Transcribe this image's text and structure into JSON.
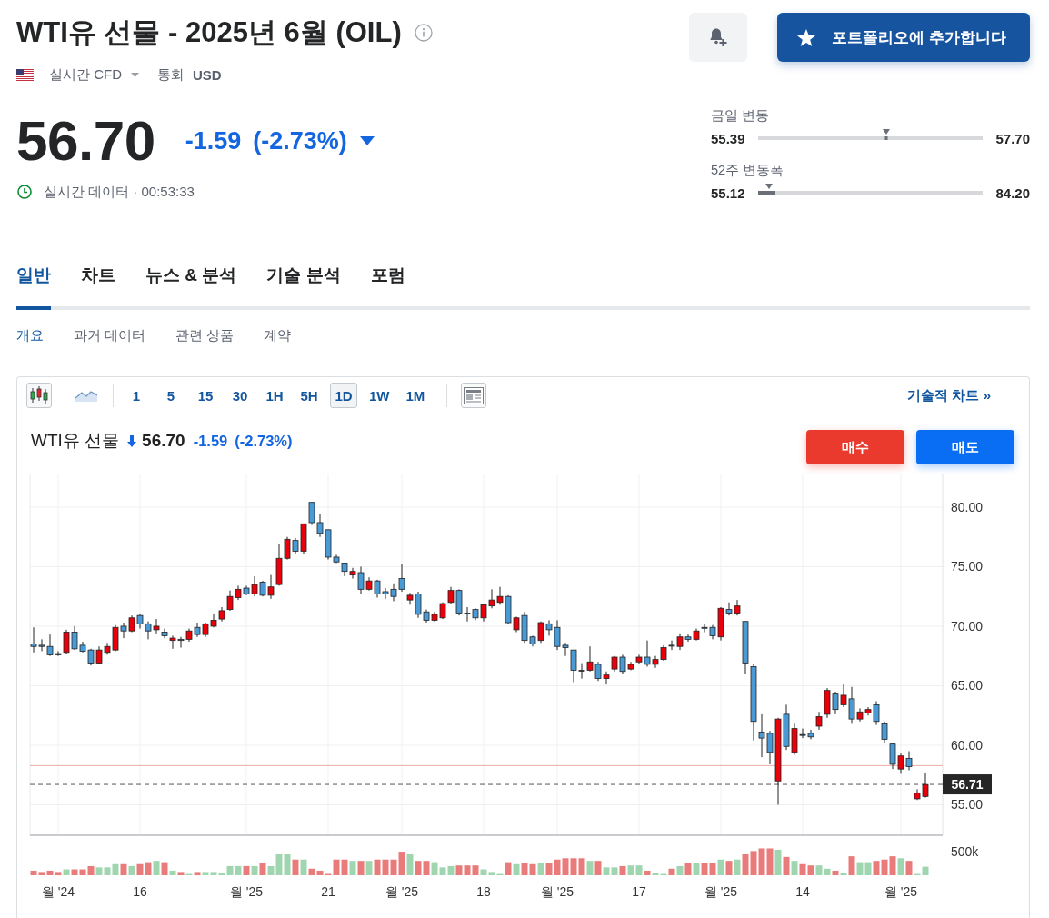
{
  "header": {
    "title": "WTI유 선물 - 2025년 6월 (OIL)",
    "market": "실시간 CFD",
    "currency_label": "통화",
    "currency": "USD"
  },
  "portfolio_button": {
    "label": "포트폴리오에 추가합니다"
  },
  "quote": {
    "price": "56.70",
    "change": "-1.59",
    "change_percent": "(-2.73%)",
    "falling": true,
    "status": "실시간 데이터 · 00:53:33"
  },
  "ranges": [
    {
      "kind": "day",
      "label": "금일 변동",
      "low": "55.39",
      "high": "57.70",
      "level": 0.57
    },
    {
      "kind": "year",
      "label": "52주 변동폭",
      "low": "55.12",
      "high": "84.20",
      "level": 0.05
    }
  ],
  "tabs": [
    {
      "label": "일반",
      "selected": true
    },
    {
      "label": "차트",
      "selected": false
    },
    {
      "label": "뉴스 & 분석",
      "selected": false
    },
    {
      "label": "기술 분석",
      "selected": false
    },
    {
      "label": "포럼",
      "selected": false
    }
  ],
  "subtabs": [
    {
      "label": "개요",
      "selected": true
    },
    {
      "label": "과거 데이터",
      "selected": false
    },
    {
      "label": "관련 상품",
      "selected": false
    },
    {
      "label": "계약",
      "selected": false
    }
  ],
  "chart": {
    "chart_types": [
      {
        "kind": "candlestick",
        "selected": true
      },
      {
        "kind": "area",
        "selected": false
      }
    ],
    "intervals": [
      {
        "label": "1",
        "selected": false
      },
      {
        "label": "5",
        "selected": false
      },
      {
        "label": "15",
        "selected": false
      },
      {
        "label": "30",
        "selected": false
      },
      {
        "label": "1H",
        "selected": false
      },
      {
        "label": "5H",
        "selected": false
      },
      {
        "label": "1D",
        "selected": true
      },
      {
        "label": "1W",
        "selected": false
      },
      {
        "label": "1M",
        "selected": false
      }
    ],
    "technical_link": "기술적 차트 »",
    "legend": {
      "name": "WTI유 선물",
      "falling": true,
      "price": "56.70",
      "change": "-1.59",
      "change_percent": "(-2.73%)"
    },
    "trade_buttons": [
      {
        "kind": "buy",
        "label": "매수"
      },
      {
        "kind": "sell",
        "label": "매도"
      }
    ],
    "volume_axis_label": "500k",
    "chart_data": {
      "type": "candlestick",
      "grid": true,
      "categories": [
        null,
        null,
        null,
        "월 '24",
        null,
        null,
        null,
        null,
        null,
        null,
        null,
        null,
        null,
        "16",
        null,
        null,
        null,
        null,
        null,
        null,
        null,
        null,
        null,
        null,
        null,
        null,
        "월 '25",
        null,
        null,
        null,
        null,
        null,
        null,
        null,
        null,
        null,
        "21",
        null,
        null,
        null,
        null,
        null,
        null,
        null,
        null,
        "월 '25",
        null,
        null,
        null,
        null,
        null,
        null,
        null,
        null,
        null,
        "18",
        null,
        null,
        null,
        null,
        null,
        null,
        null,
        null,
        "월 '25",
        null,
        null,
        null,
        null,
        null,
        null,
        null,
        null,
        null,
        "17",
        null,
        null,
        null,
        null,
        null,
        null,
        null,
        null,
        null,
        "월 '25",
        null,
        null,
        null,
        null,
        null,
        null,
        null,
        null,
        null,
        "14",
        null,
        null,
        null,
        null,
        null,
        null,
        null,
        null,
        null,
        null,
        null,
        "월 '25",
        null,
        null,
        null
      ],
      "ohlc": [
        [
          68.5,
          69.9,
          67.8,
          68.3
        ],
        [
          68.4,
          68.9,
          67.9,
          68.3
        ],
        [
          68.3,
          69.3,
          67.5,
          67.6
        ],
        [
          67.7,
          67.9,
          67.5,
          67.6
        ],
        [
          67.8,
          69.7,
          67.7,
          69.5
        ],
        [
          69.5,
          70.0,
          68.0,
          68.1
        ],
        [
          68.4,
          68.7,
          67.8,
          67.9
        ],
        [
          68.0,
          68.1,
          66.7,
          66.9
        ],
        [
          66.9,
          68.3,
          66.8,
          68.0
        ],
        [
          67.8,
          68.6,
          67.6,
          68.3
        ],
        [
          68.0,
          70.1,
          67.9,
          69.9
        ],
        [
          70.0,
          70.3,
          69.0,
          69.6
        ],
        [
          69.6,
          70.9,
          69.5,
          70.7
        ],
        [
          70.9,
          71.0,
          69.8,
          70.2
        ],
        [
          70.2,
          70.4,
          68.9,
          69.6
        ],
        [
          69.7,
          70.6,
          69.4,
          70.0
        ],
        [
          69.5,
          69.8,
          69.0,
          69.2
        ],
        [
          68.8,
          69.2,
          68.1,
          69.0
        ],
        [
          68.9,
          69.1,
          68.2,
          68.8
        ],
        [
          68.9,
          69.8,
          68.7,
          69.6
        ],
        [
          69.9,
          70.3,
          69.1,
          69.3
        ],
        [
          69.3,
          70.3,
          69.1,
          70.2
        ],
        [
          70.0,
          71.0,
          69.9,
          70.5
        ],
        [
          70.6,
          71.6,
          70.4,
          71.3
        ],
        [
          71.4,
          73.0,
          71.3,
          72.5
        ],
        [
          72.4,
          73.4,
          72.2,
          73.1
        ],
        [
          73.2,
          73.4,
          72.6,
          72.7
        ],
        [
          72.7,
          74.2,
          72.5,
          73.5
        ],
        [
          73.7,
          73.8,
          72.5,
          72.6
        ],
        [
          72.6,
          74.3,
          72.3,
          73.3
        ],
        [
          73.5,
          76.9,
          73.4,
          75.7
        ],
        [
          75.7,
          77.5,
          75.6,
          77.3
        ],
        [
          77.2,
          77.4,
          76.1,
          76.3
        ],
        [
          76.3,
          78.6,
          76.1,
          78.6
        ],
        [
          80.4,
          80.4,
          78.5,
          78.7
        ],
        [
          78.7,
          79.4,
          77.5,
          77.8
        ],
        [
          78.1,
          78.1,
          75.6,
          75.8
        ],
        [
          75.8,
          76.0,
          75.3,
          75.4
        ],
        [
          75.3,
          75.3,
          74.2,
          74.6
        ],
        [
          74.3,
          74.9,
          74.0,
          74.6
        ],
        [
          74.5,
          75.0,
          72.7,
          73.1
        ],
        [
          73.1,
          74.1,
          73.0,
          73.8
        ],
        [
          73.8,
          73.9,
          72.4,
          72.7
        ],
        [
          72.9,
          73.2,
          72.3,
          72.7
        ],
        [
          73.1,
          73.6,
          72.1,
          72.5
        ],
        [
          74.0,
          75.2,
          72.9,
          73.1
        ],
        [
          72.2,
          72.8,
          71.8,
          72.6
        ],
        [
          72.7,
          72.9,
          70.7,
          71.0
        ],
        [
          71.2,
          71.4,
          70.3,
          70.5
        ],
        [
          70.5,
          71.2,
          70.4,
          71.0
        ],
        [
          70.7,
          72.0,
          70.6,
          71.9
        ],
        [
          72.0,
          73.3,
          71.9,
          73.0
        ],
        [
          73.0,
          73.1,
          70.9,
          71.1
        ],
        [
          71.1,
          71.6,
          70.4,
          71.1
        ],
        [
          71.4,
          71.5,
          70.5,
          70.7
        ],
        [
          70.7,
          71.9,
          70.4,
          71.8
        ],
        [
          71.7,
          73.1,
          71.5,
          72.2
        ],
        [
          72.0,
          73.3,
          71.8,
          72.5
        ],
        [
          72.5,
          72.6,
          70.2,
          70.3
        ],
        [
          69.7,
          70.8,
          69.5,
          70.7
        ],
        [
          70.9,
          71.2,
          68.6,
          68.8
        ],
        [
          69.1,
          69.2,
          68.3,
          68.5
        ],
        [
          68.8,
          70.4,
          68.6,
          70.3
        ],
        [
          70.2,
          70.5,
          69.2,
          69.7
        ],
        [
          69.9,
          70.5,
          68.0,
          68.3
        ],
        [
          68.4,
          68.6,
          67.5,
          68.2
        ],
        [
          68.0,
          68.0,
          65.3,
          66.3
        ],
        [
          66.3,
          66.9,
          65.6,
          66.3
        ],
        [
          66.3,
          68.3,
          66.2,
          67.0
        ],
        [
          66.8,
          67.0,
          65.4,
          65.6
        ],
        [
          65.6,
          66.2,
          65.1,
          65.9
        ],
        [
          66.4,
          67.5,
          66.2,
          67.4
        ],
        [
          67.4,
          67.6,
          66.0,
          66.2
        ],
        [
          66.4,
          67.0,
          66.3,
          66.8
        ],
        [
          67.0,
          67.6,
          66.8,
          67.4
        ],
        [
          67.4,
          68.8,
          66.6,
          66.8
        ],
        [
          66.8,
          67.5,
          66.5,
          67.2
        ],
        [
          67.2,
          68.4,
          67.1,
          68.2
        ],
        [
          68.4,
          68.8,
          68.0,
          68.4
        ],
        [
          68.3,
          69.4,
          68.0,
          69.1
        ],
        [
          69.1,
          69.3,
          68.7,
          68.9
        ],
        [
          68.9,
          69.8,
          68.8,
          69.6
        ],
        [
          69.9,
          70.2,
          69.5,
          69.9
        ],
        [
          69.9,
          70.1,
          68.9,
          69.2
        ],
        [
          69.1,
          71.6,
          68.8,
          71.5
        ],
        [
          71.4,
          72.0,
          70.9,
          71.1
        ],
        [
          71.1,
          72.2,
          70.9,
          71.7
        ],
        [
          70.4,
          70.4,
          66.0,
          66.9
        ],
        [
          66.6,
          66.8,
          60.4,
          62.0
        ],
        [
          61.1,
          62.6,
          59.0,
          60.6
        ],
        [
          61.0,
          61.2,
          58.4,
          59.4
        ],
        [
          57.0,
          62.3,
          55.0,
          62.2
        ],
        [
          62.6,
          63.4,
          59.6,
          59.9
        ],
        [
          59.4,
          61.8,
          59.2,
          61.4
        ],
        [
          60.9,
          61.4,
          60.6,
          60.9
        ],
        [
          61.0,
          61.3,
          60.5,
          60.7
        ],
        [
          61.6,
          62.8,
          61.3,
          62.4
        ],
        [
          62.6,
          64.8,
          62.3,
          64.6
        ],
        [
          64.3,
          64.5,
          62.6,
          63.0
        ],
        [
          63.4,
          65.1,
          63.2,
          64.2
        ],
        [
          63.9,
          64.9,
          61.8,
          62.2
        ],
        [
          62.2,
          63.1,
          62.0,
          62.8
        ],
        [
          62.7,
          63.2,
          62.5,
          63.0
        ],
        [
          63.4,
          63.7,
          61.7,
          62.0
        ],
        [
          61.8,
          62.0,
          60.2,
          60.5
        ],
        [
          60.1,
          60.2,
          58.0,
          58.4
        ],
        [
          58.0,
          59.3,
          57.6,
          59.1
        ],
        [
          58.9,
          59.5,
          57.9,
          58.2
        ],
        [
          55.5,
          56.3,
          55.4,
          56.0
        ],
        [
          55.7,
          57.7,
          55.6,
          56.7
        ]
      ],
      "ylim": [
        52.44,
        82.82
      ],
      "yticks": [
        {
          "value": 80,
          "label": "80.00"
        },
        {
          "value": 75,
          "label": "75.00"
        },
        {
          "value": 70,
          "label": "70.00"
        },
        {
          "value": 65,
          "label": "65.00"
        },
        {
          "value": 60,
          "label": "60.00"
        },
        {
          "value": 55,
          "label": "55.00"
        }
      ],
      "ref_lines": [
        {
          "axis": "y",
          "value": 58.29,
          "color": "#f0aaaa"
        },
        {
          "axis": "y",
          "value": 56.71,
          "color": "#555555",
          "label": "56.71"
        }
      ]
    }
  }
}
